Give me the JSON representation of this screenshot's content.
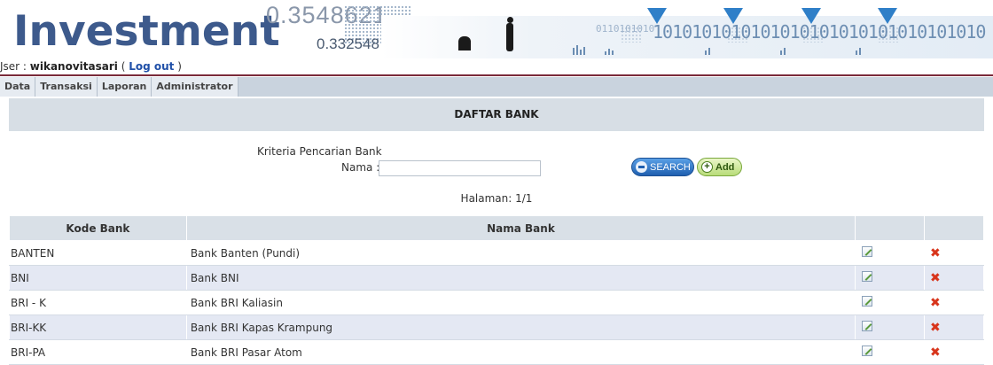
{
  "banner": {
    "brand": "Investment",
    "number_large": "0.3548621",
    "number_small": "0.332548",
    "binary_text": "1010101010101010101010101010101010",
    "binary_repeat": "0110101010",
    "binary_end": "101010"
  },
  "user": {
    "prefix": "Jser : ",
    "name": "wikanovitasari",
    "open": " ( ",
    "logout": "Log out",
    "close": " )"
  },
  "menu": [
    "Data",
    "Transaksi",
    "Laporan",
    "Administrator"
  ],
  "page": {
    "title": "DAFTAR BANK",
    "criteria_label": "Kriteria Pencarian Bank",
    "name_label": "Nama :",
    "name_value": "",
    "search_button": "SEARCH",
    "add_button": "Add",
    "pagination": "Halaman: 1/1"
  },
  "table": {
    "headers": [
      "Kode Bank",
      "Nama Bank",
      "",
      ""
    ],
    "rows": [
      {
        "kode": "BANTEN",
        "nama": "Bank Banten (Pundi)"
      },
      {
        "kode": "BNI",
        "nama": "Bank BNI"
      },
      {
        "kode": "BRI - K",
        "nama": "Bank BRI Kaliasin"
      },
      {
        "kode": "BRI-KK",
        "nama": "Bank BRI Kapas Krampung"
      },
      {
        "kode": "BRI-PA",
        "nama": "Bank BRI Pasar Atom"
      }
    ]
  },
  "colors": {
    "brand": "#3d5a8c",
    "title_bar": "#d7dee5",
    "row_alt": "#e4e8f3",
    "delete": "#d8351c"
  },
  "icons": {
    "edit": "edit-icon",
    "delete": "delete-icon",
    "search": "search-icon",
    "add": "plus-icon"
  }
}
